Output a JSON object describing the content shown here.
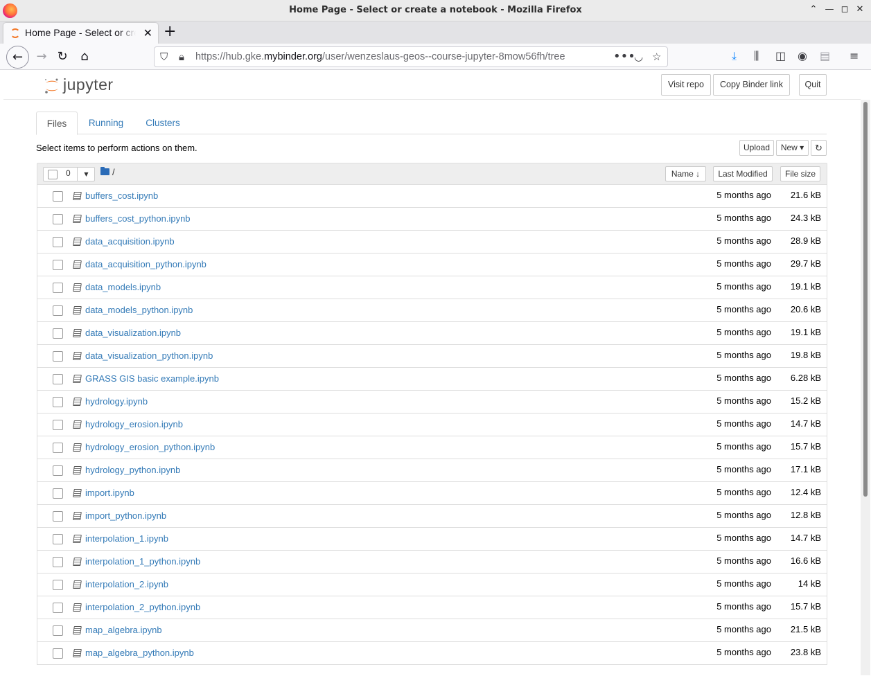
{
  "window": {
    "title": "Home Page - Select or create a notebook - Mozilla Firefox",
    "controls": [
      "minimize",
      "maximize",
      "close"
    ]
  },
  "browser": {
    "tab_title": "Home Page - Select or create a notebook",
    "url_prefix": "https://hub.gke.",
    "url_domain": "mybinder.org",
    "url_path": "/user/wenzeslaus-geos--course-jupyter-8mow56fh/tree"
  },
  "header": {
    "logo_text": "jupyter",
    "visit_repo": "Visit repo",
    "copy_binder": "Copy Binder link",
    "quit": "Quit"
  },
  "tabs": [
    {
      "label": "Files"
    },
    {
      "label": "Running"
    },
    {
      "label": "Clusters"
    }
  ],
  "toolbar": {
    "hint": "Select items to perform actions on them.",
    "upload": "Upload",
    "new": "New ▾",
    "refresh_icon": "refresh-icon"
  },
  "list_header": {
    "selected_count": "0",
    "breadcrumb": "/",
    "col_name": "Name ↓",
    "col_modified": "Last Modified",
    "col_size": "File size"
  },
  "files": [
    {
      "name": "buffers_cost.ipynb",
      "modified": "5 months ago",
      "size": "21.6 kB"
    },
    {
      "name": "buffers_cost_python.ipynb",
      "modified": "5 months ago",
      "size": "24.3 kB"
    },
    {
      "name": "data_acquisition.ipynb",
      "modified": "5 months ago",
      "size": "28.9 kB"
    },
    {
      "name": "data_acquisition_python.ipynb",
      "modified": "5 months ago",
      "size": "29.7 kB"
    },
    {
      "name": "data_models.ipynb",
      "modified": "5 months ago",
      "size": "19.1 kB"
    },
    {
      "name": "data_models_python.ipynb",
      "modified": "5 months ago",
      "size": "20.6 kB"
    },
    {
      "name": "data_visualization.ipynb",
      "modified": "5 months ago",
      "size": "19.1 kB"
    },
    {
      "name": "data_visualization_python.ipynb",
      "modified": "5 months ago",
      "size": "19.8 kB"
    },
    {
      "name": "GRASS GIS basic example.ipynb",
      "modified": "5 months ago",
      "size": "6.28 kB"
    },
    {
      "name": "hydrology.ipynb",
      "modified": "5 months ago",
      "size": "15.2 kB"
    },
    {
      "name": "hydrology_erosion.ipynb",
      "modified": "5 months ago",
      "size": "14.7 kB"
    },
    {
      "name": "hydrology_erosion_python.ipynb",
      "modified": "5 months ago",
      "size": "15.7 kB"
    },
    {
      "name": "hydrology_python.ipynb",
      "modified": "5 months ago",
      "size": "17.1 kB"
    },
    {
      "name": "import.ipynb",
      "modified": "5 months ago",
      "size": "12.4 kB"
    },
    {
      "name": "import_python.ipynb",
      "modified": "5 months ago",
      "size": "12.8 kB"
    },
    {
      "name": "interpolation_1.ipynb",
      "modified": "5 months ago",
      "size": "14.7 kB"
    },
    {
      "name": "interpolation_1_python.ipynb",
      "modified": "5 months ago",
      "size": "16.6 kB"
    },
    {
      "name": "interpolation_2.ipynb",
      "modified": "5 months ago",
      "size": "14 kB"
    },
    {
      "name": "interpolation_2_python.ipynb",
      "modified": "5 months ago",
      "size": "15.7 kB"
    },
    {
      "name": "map_algebra.ipynb",
      "modified": "5 months ago",
      "size": "21.5 kB"
    },
    {
      "name": "map_algebra_python.ipynb",
      "modified": "5 months ago",
      "size": "23.8 kB"
    }
  ],
  "colors": {
    "link": "#337ab7",
    "jupyter_orange": "#f37726",
    "folder_blue": "#2a6bb7"
  }
}
